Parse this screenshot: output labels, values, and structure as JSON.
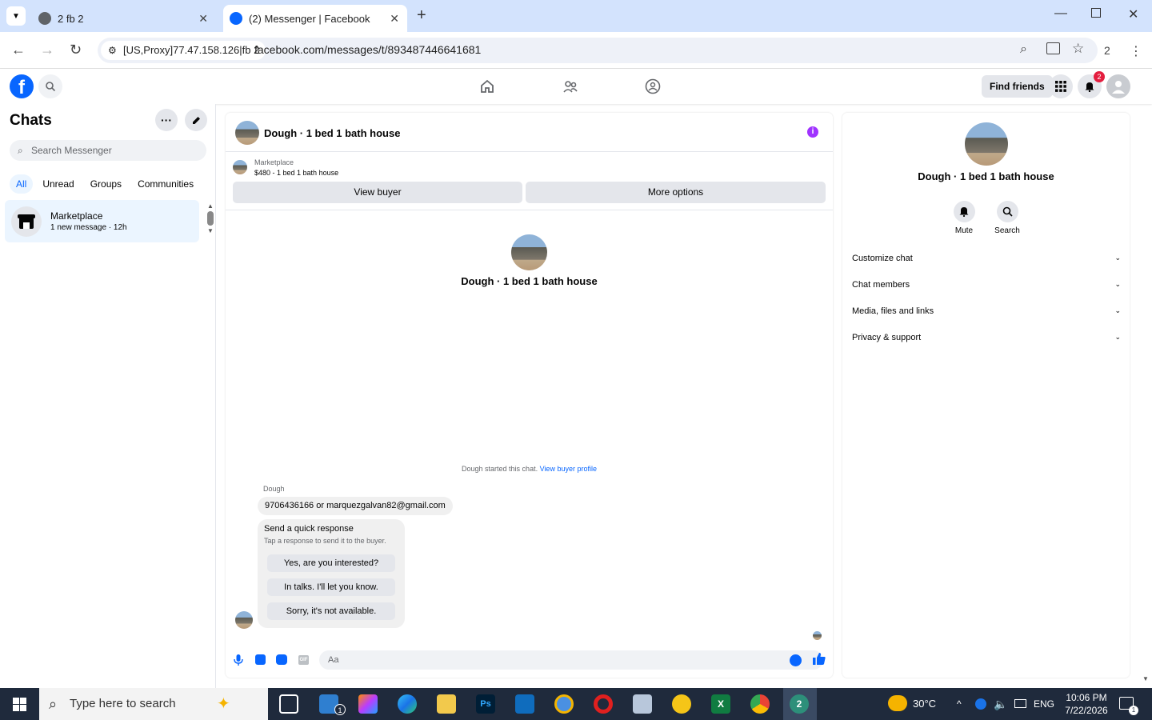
{
  "browser": {
    "tabs": [
      {
        "title": "2 fb 2",
        "active": false
      },
      {
        "title": "(2) Messenger | Facebook",
        "active": true
      }
    ],
    "site_chip": "[US,Proxy]77.47.158.126|fb 2",
    "url": "facebook.com/messages/t/893487446641681",
    "profile_count": "2"
  },
  "fb_header": {
    "find_friends": "Find friends",
    "notification_count": "2"
  },
  "sidebar": {
    "title": "Chats",
    "search_placeholder": "Search Messenger",
    "filters": [
      "All",
      "Unread",
      "Groups",
      "Communities"
    ],
    "chats": [
      {
        "name": "Marketplace",
        "subtitle": "1 new message · 12h"
      }
    ]
  },
  "chat": {
    "title": "Dough · 1 bed 1 bath house",
    "marketplace_label": "Marketplace",
    "listing": "$480 - 1 bed 1 bath house",
    "view_buyer": "View buyer",
    "more_options": "More options",
    "intro_name": "Dough · 1 bed 1 bath house",
    "started_text": "Dough started this chat.",
    "started_link": "View buyer profile",
    "sender": "Dough",
    "message": "9706436166 or marquezgalvan82@gmail.com",
    "quick_response": {
      "title": "Send a quick response",
      "subtitle": "Tap a response to send it to the buyer.",
      "options": [
        "Yes, are you interested?",
        "In talks. I'll let you know.",
        "Sorry, it's not available."
      ]
    },
    "composer_placeholder": "Aa"
  },
  "info_panel": {
    "name": "Dough · 1 bed 1 bath house",
    "actions": [
      "Mute",
      "Search"
    ],
    "sections": [
      "Customize chat",
      "Chat members",
      "Media, files and links",
      "Privacy & support"
    ]
  },
  "taskbar": {
    "search_placeholder": "Type here to search",
    "weather": "30°C",
    "language": "ENG",
    "time": "10:06 PM",
    "date": "7/22/2026",
    "mail_badge": "1",
    "notification_badge": "1",
    "chrome2_badge": "2"
  },
  "colors": {
    "fb_blue": "#0866ff",
    "chrome_tab_bg": "#d3e3fd",
    "taskbar": "#1f2a3c"
  }
}
